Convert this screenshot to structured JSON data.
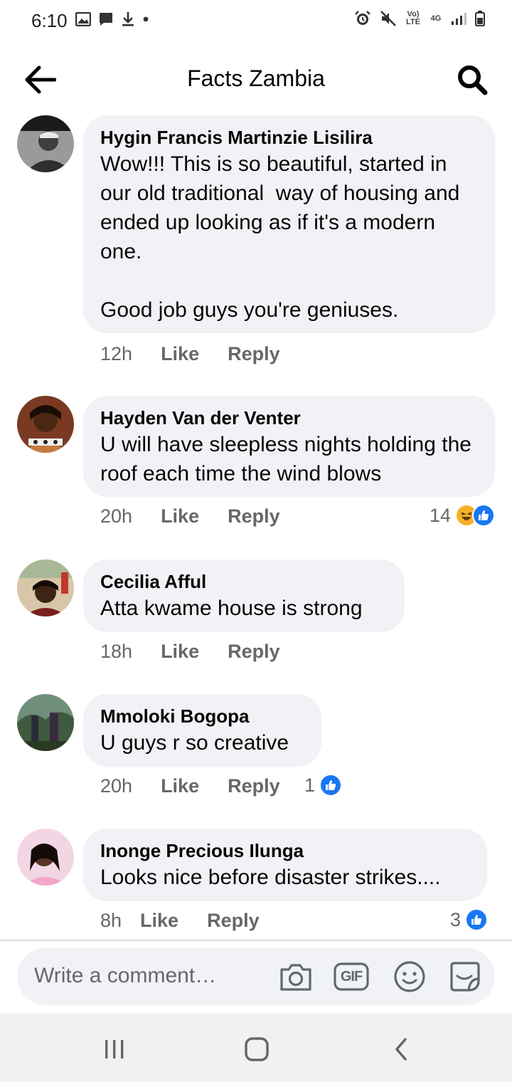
{
  "status_bar": {
    "time": "6:10",
    "lte_label": "Vo) LTE",
    "network_label": "4G"
  },
  "header": {
    "title": "Facts Zambia"
  },
  "comments": [
    {
      "author": "Hygin Francis Martinzie Lisilira",
      "text": "Wow!!! This is so beautiful, started in our old traditional  way of housing and ended up looking as if it's a modern one.\n\nGood job guys you're geniuses.",
      "time": "12h",
      "like_label": "Like",
      "reply_label": "Reply",
      "reaction_count": ""
    },
    {
      "author": "Hayden Van der Venter",
      "text": "U will have sleepless nights holding the roof each time the wind blows",
      "time": "20h",
      "like_label": "Like",
      "reply_label": "Reply",
      "reaction_count": "14"
    },
    {
      "author": "Cecilia Afful",
      "text": "Atta kwame house is strong",
      "time": "18h",
      "like_label": "Like",
      "reply_label": "Reply",
      "reaction_count": ""
    },
    {
      "author": "Mmoloki Bogopa",
      "text": "U guys r so creative",
      "time": "20h",
      "like_label": "Like",
      "reply_label": "Reply",
      "reaction_count": "1"
    },
    {
      "author": "Inonge Precious Ilunga",
      "text": "Looks nice before disaster strikes....",
      "time": "8h",
      "like_label": "Like",
      "reply_label": "Reply",
      "reaction_count": "3"
    }
  ],
  "composer": {
    "placeholder": "Write a comment…",
    "gif_label": "GIF"
  },
  "colors": {
    "accent": "#1877f2",
    "bubble": "#f0f2f5",
    "muted_text": "#65676b"
  }
}
